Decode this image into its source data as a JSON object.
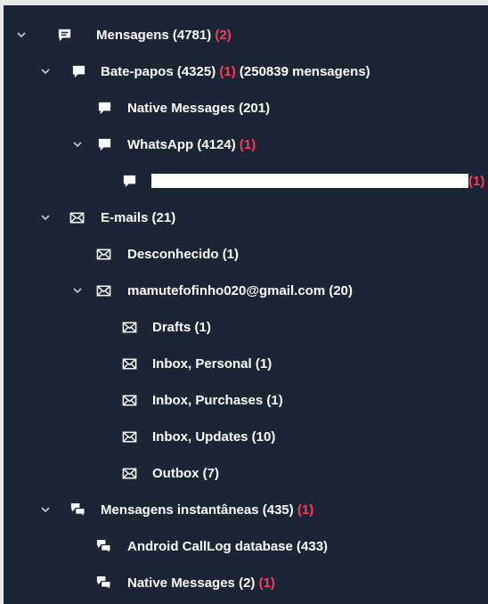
{
  "tree": [
    {
      "id": "r0",
      "name": "mensagens",
      "label": "Mensagens (4781)",
      "badge": "(2)",
      "icon": "chat-square",
      "expandable": true
    },
    {
      "id": "r1",
      "name": "bate-papos",
      "label": "Bate-papos (4325)",
      "badge": "(1)",
      "suffix": "(250839 mensagens)",
      "icon": "chat-bubble",
      "expandable": true
    },
    {
      "id": "r2",
      "name": "native-messages-chat",
      "label": "Native Messages (201)",
      "icon": "chat-bubble",
      "expandable": false
    },
    {
      "id": "r3",
      "name": "whatsapp",
      "label": "WhatsApp (4124)",
      "badge": "(1)",
      "icon": "chat-bubble",
      "expandable": true
    },
    {
      "id": "r4",
      "name": "whatsapp-redacted-chat",
      "label": "",
      "redacted": true,
      "badge": "(1)",
      "icon": "chat-bubble",
      "expandable": false
    },
    {
      "id": "r5",
      "name": "e-mails",
      "label": "E-mails (21)",
      "icon": "envelope",
      "expandable": true
    },
    {
      "id": "r6",
      "name": "desconhecido",
      "label": "Desconhecido (1)",
      "icon": "envelope",
      "expandable": false
    },
    {
      "id": "r7",
      "name": "gmail-account",
      "label": "mamutefofinho020@gmail.com (20)",
      "icon": "envelope",
      "expandable": true
    },
    {
      "id": "r8",
      "name": "drafts",
      "label": "Drafts (1)",
      "icon": "envelope",
      "expandable": false
    },
    {
      "id": "r9",
      "name": "inbox-personal",
      "label": "Inbox, Personal (1)",
      "icon": "envelope",
      "expandable": false
    },
    {
      "id": "r10",
      "name": "inbox-purchases",
      "label": "Inbox, Purchases (1)",
      "icon": "envelope",
      "expandable": false
    },
    {
      "id": "r11",
      "name": "inbox-updates",
      "label": "Inbox, Updates (10)",
      "icon": "envelope",
      "expandable": false
    },
    {
      "id": "r12",
      "name": "outbox",
      "label": "Outbox (7)",
      "icon": "envelope",
      "expandable": false
    },
    {
      "id": "r13",
      "name": "mensagens-instantaneas",
      "label": "Mensagens instantâneas (435)",
      "badge": "(1)",
      "icon": "chat-multi",
      "expandable": true
    },
    {
      "id": "r14",
      "name": "android-calllog",
      "label": "Android CallLog database (433)",
      "icon": "chat-multi",
      "expandable": false
    },
    {
      "id": "r15",
      "name": "native-messages-im",
      "label": "Native Messages (2)",
      "badge": "(1)",
      "icon": "chat-multi",
      "expandable": false
    }
  ],
  "colors": {
    "background": "#1c2535",
    "text": "#ffffff",
    "badge": "#ff3b5c",
    "chevron": "#c8ccd3"
  }
}
